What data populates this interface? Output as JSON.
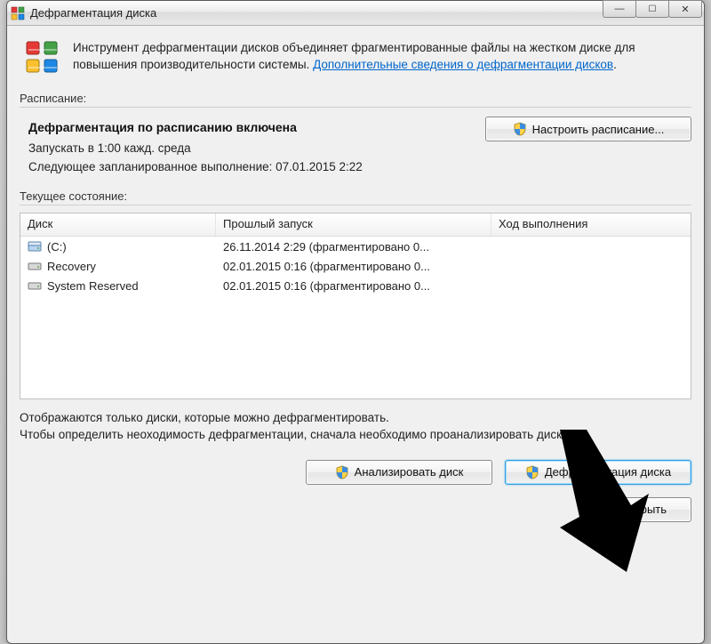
{
  "window": {
    "title": "Дефрагментация диска"
  },
  "header": {
    "description": "Инструмент дефрагментации дисков объединяет фрагментированные файлы на жестком диске для повышения производительности системы. ",
    "help_link": "Дополнительные сведения о дефрагментации дисков",
    "help_link_suffix": "."
  },
  "schedule": {
    "section_label": "Расписание:",
    "title": "Дефрагментация по расписанию включена",
    "run_at": "Запускать в 1:00 кажд. среда",
    "next_run": "Следующее запланированное выполнение: 07.01.2015 2:22",
    "configure_button": "Настроить расписание..."
  },
  "current": {
    "section_label": "Текущее состояние:"
  },
  "table": {
    "headers": {
      "disk": "Диск",
      "last_run": "Прошлый запуск",
      "progress": "Ход выполнения"
    },
    "rows": [
      {
        "name": "(C:)",
        "last": "26.11.2014 2:29 (фрагментировано 0...",
        "icon": "c"
      },
      {
        "name": "Recovery",
        "last": "02.01.2015 0:16 (фрагментировано 0...",
        "icon": "hdd"
      },
      {
        "name": "System Reserved",
        "last": "02.01.2015 0:16 (фрагментировано 0...",
        "icon": "hdd"
      }
    ]
  },
  "info": {
    "line1": "Отображаются только диски, которые можно дефрагментировать.",
    "line2": "Чтобы определить неоходимость  дефрагментации, сначала необходимо проанализировать диски."
  },
  "buttons": {
    "analyze": "Анализировать диск",
    "defrag": "Дефрагментация диска",
    "close": "Закрыть"
  }
}
